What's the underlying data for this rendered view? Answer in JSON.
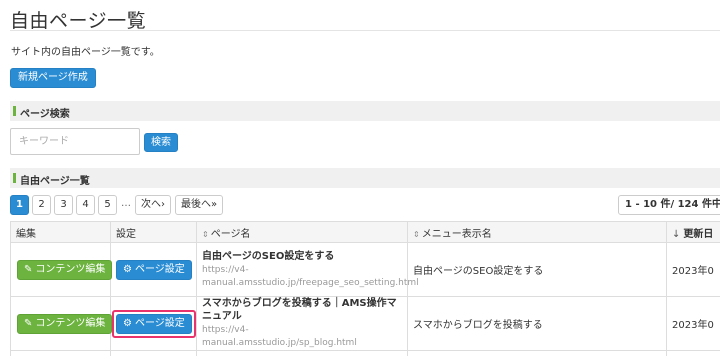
{
  "page": {
    "title": "自由ページ一覧",
    "description": "サイト内の自由ページ一覧です。",
    "new_button": "新規ページ作成"
  },
  "search": {
    "section_label": "ページ検索",
    "placeholder": "キーワード",
    "button": "検索"
  },
  "list": {
    "section_label": "自由ページ一覧",
    "pager": {
      "pages": [
        "1",
        "2",
        "3",
        "4",
        "5"
      ],
      "active_page": "1",
      "ellipsis": "…",
      "next": "次へ›",
      "last": "最後へ»"
    },
    "count_text": "1 - 10 件/ 124 件中",
    "columns": {
      "edit": "編集",
      "setting": "設定",
      "page_name": "ページ名",
      "menu_name": "メニュー表示名",
      "updated": "更新日"
    },
    "rows": [
      {
        "edit_label": "コンテンツ編集",
        "setting_label": "ページ設定",
        "page_name": "自由ページのSEO設定をする",
        "url": "https://v4-manual.amsstudio.jp/freepage_seo_setting.html",
        "menu_name": "自由ページのSEO設定をする",
        "updated": "2023年0"
      },
      {
        "edit_label": "コンテンツ編集",
        "setting_label": "ページ設定",
        "page_name": "スマホからブログを投稿する｜AMS操作マニュアル",
        "url": "https://v4-manual.amsstudio.jp/sp_blog.html",
        "menu_name": "スマホからブログを投稿する",
        "updated": "2023年0"
      }
    ]
  },
  "colors": {
    "primary": "#2a8dd4",
    "success": "#6cb33f",
    "highlight": "#e8336d"
  }
}
